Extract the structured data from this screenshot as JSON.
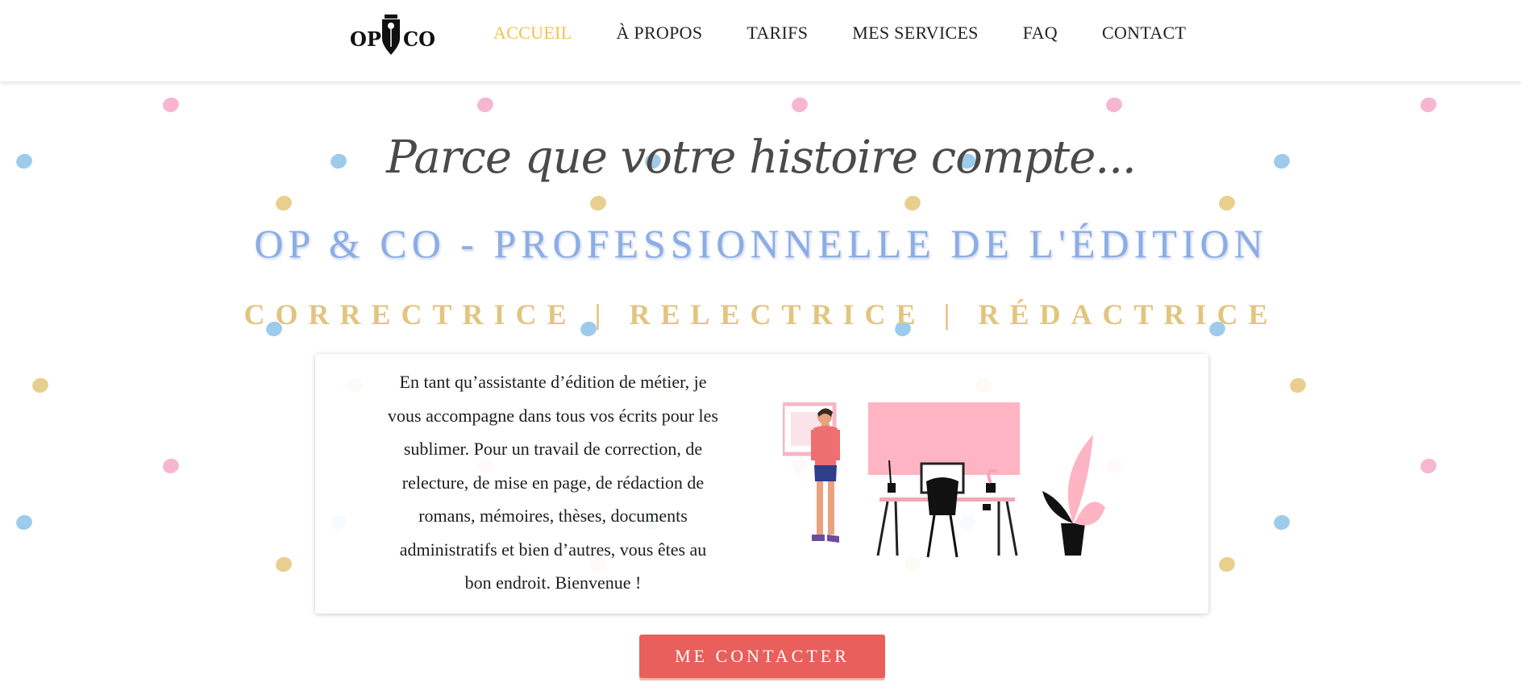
{
  "header": {
    "logo": {
      "left": "OP",
      "right": "CO",
      "icon": "fountain-pen-nib-icon"
    },
    "nav": [
      {
        "label": "ACCUEIL",
        "active": true
      },
      {
        "label": "À PROPOS",
        "active": false
      },
      {
        "label": "TARIFS",
        "active": false
      },
      {
        "label": "MES SERVICES",
        "active": false
      },
      {
        "label": "FAQ",
        "active": false
      },
      {
        "label": "CONTACT",
        "active": false
      }
    ]
  },
  "hero": {
    "tagline": "Parce que votre histoire compte...",
    "title": "OP & CO - PROFESSIONNELLE DE L'ÉDITION",
    "roles": "CORRECTRICE | RELECTRICE | RÉDACTRICE",
    "intro": "En tant qu’assistante d’édition de métier, je vous accompagne dans tous vos écrits pour les sublimer. Pour un travail de correction, de relecture, de mise en page, de rédaction de romans, mémoires, thèses, documents administratifs et bien d’autres, vous êtes au bon endroit. Bienvenue !",
    "illustration": "woman-at-desk-illustration",
    "cta_label": "ME CONTACTER"
  },
  "colors": {
    "accent_gold": "#f0c34a",
    "title_blue": "#8bade6",
    "roles_gold": "#e3c47f",
    "cta_red": "#e85f5c",
    "dot_pink": "#f7b6cf",
    "dot_blue": "#9ccbec",
    "dot_gold": "#e8cf8d"
  }
}
